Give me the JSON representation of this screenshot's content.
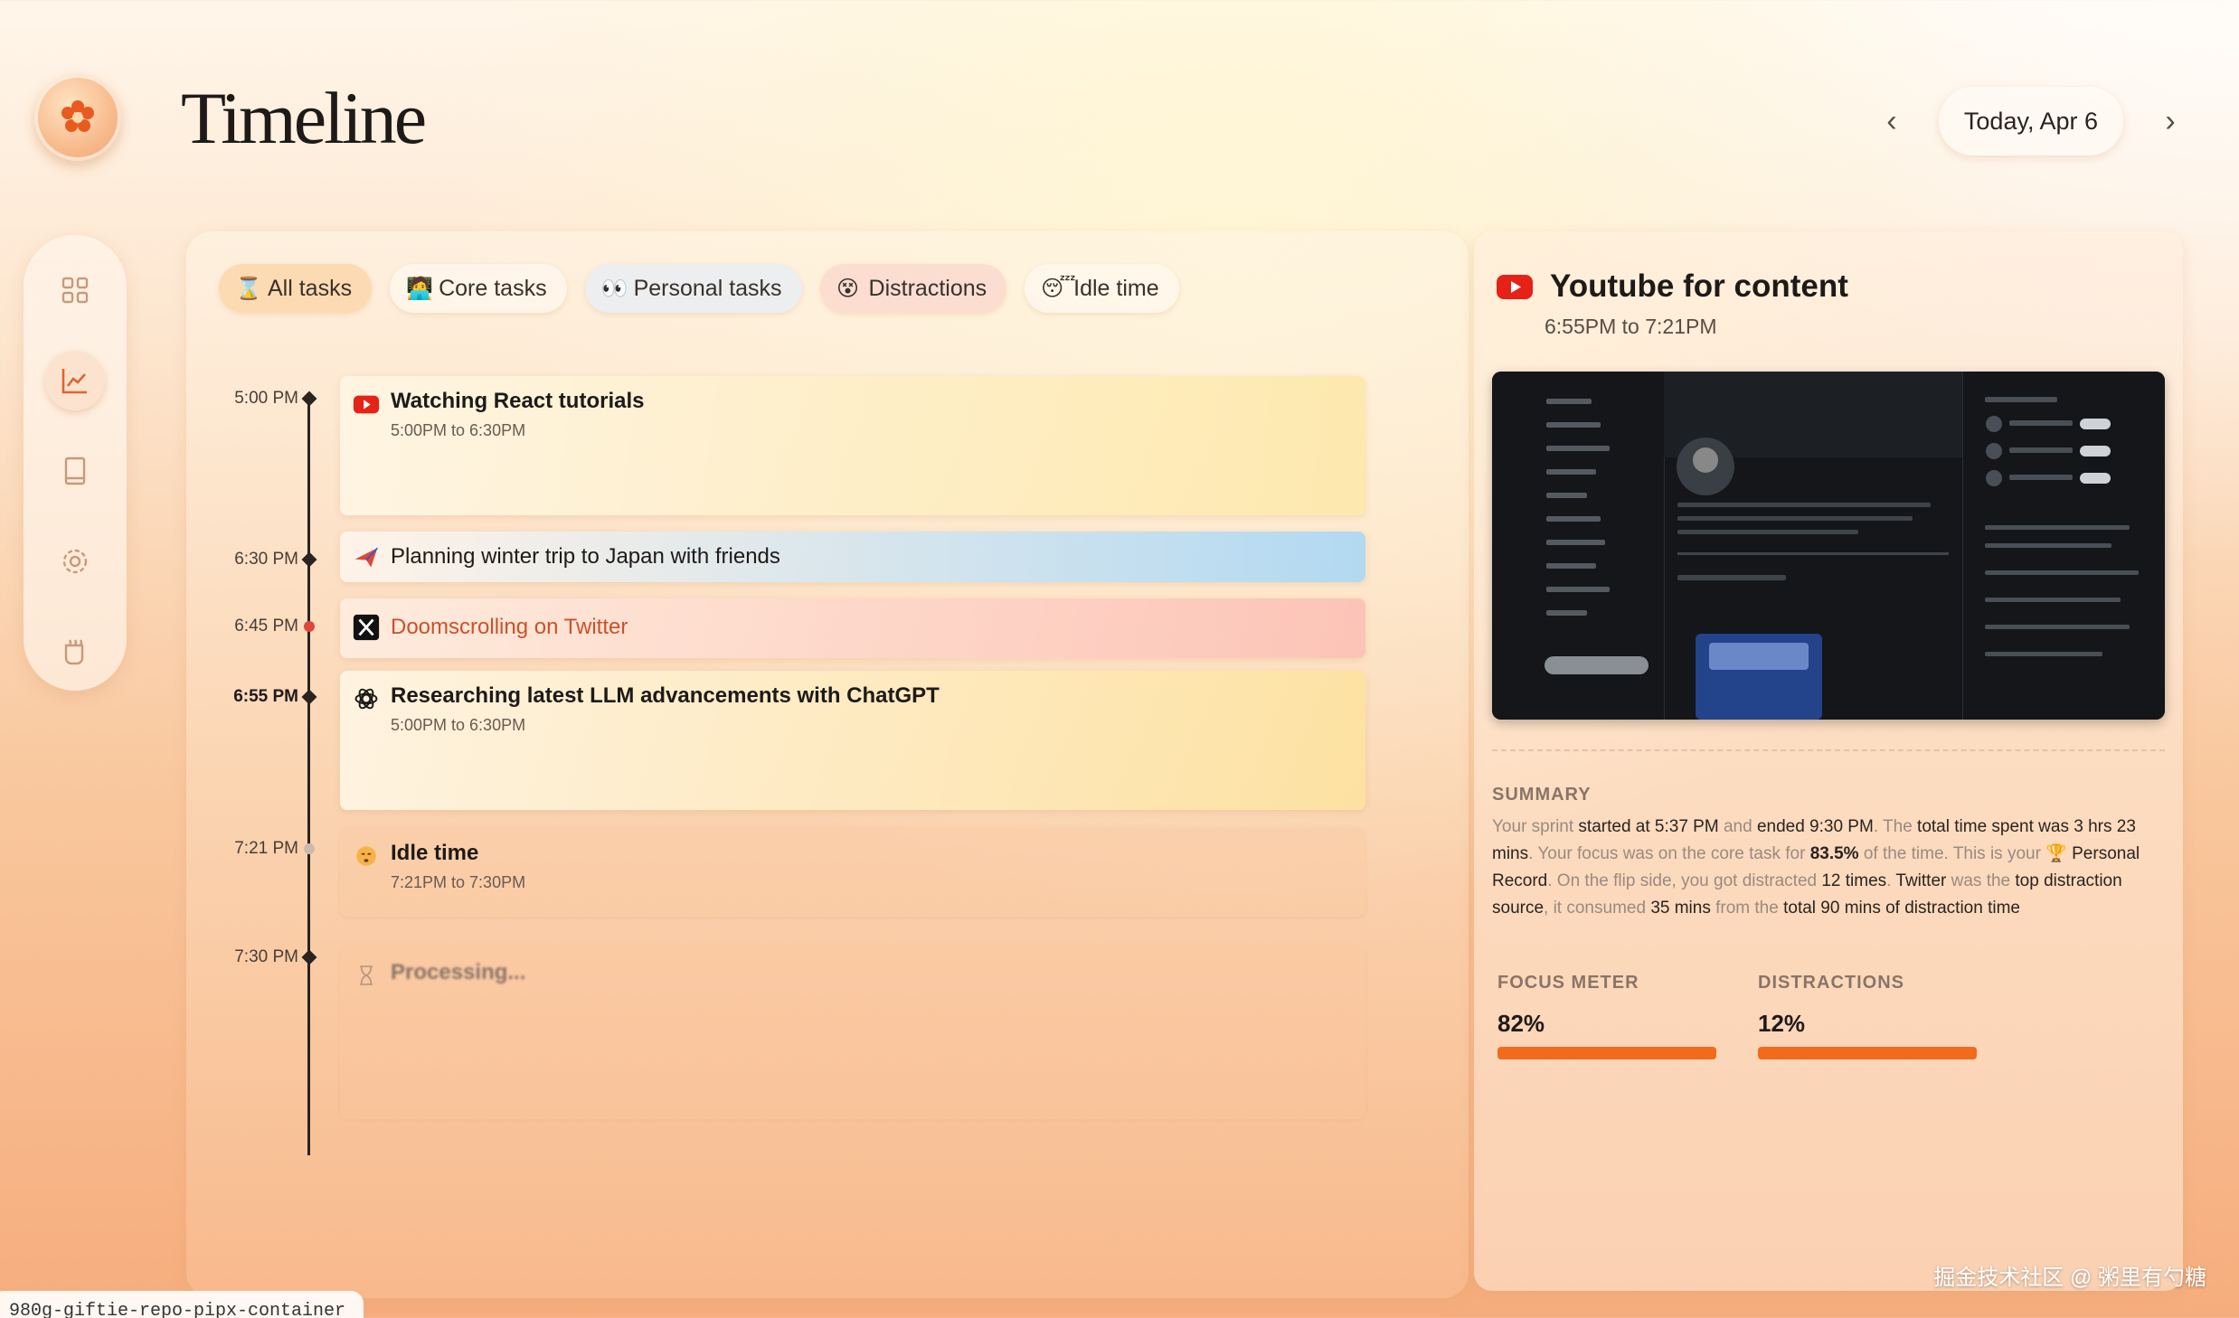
{
  "header": {
    "title": "Timeline",
    "date_label": "Today, Apr 6",
    "prev_arrow": "‹",
    "next_arrow": "›"
  },
  "sidebar": {
    "items": [
      {
        "icon": "grid-icon",
        "active": false
      },
      {
        "icon": "chart-icon",
        "active": true
      },
      {
        "icon": "tablet-icon",
        "active": false
      },
      {
        "icon": "settings-icon",
        "active": false
      },
      {
        "icon": "mug-icon",
        "active": false
      }
    ]
  },
  "filters": [
    {
      "label": "All tasks",
      "icon": "⌛",
      "active": true
    },
    {
      "label": "Core tasks",
      "icon": "🧑‍💻",
      "active": false
    },
    {
      "label": "Personal tasks",
      "icon": "👀",
      "active": false
    },
    {
      "label": "Distractions",
      "icon": "😵",
      "active": false
    },
    {
      "label": "Idle time",
      "icon": "😴",
      "active": false
    }
  ],
  "timeline": {
    "times": [
      "5:00 PM",
      "6:30 PM",
      "6:45 PM",
      "6:55 PM",
      "7:21 PM",
      "7:30 PM"
    ],
    "entries": [
      {
        "title": "Watching React tutorials",
        "sub": "5:00PM to 6:30PM",
        "icon": "youtube-icon"
      },
      {
        "title": "Planning winter trip to Japan with friends",
        "icon": "plane-icon"
      },
      {
        "title": "Doomscrolling on Twitter",
        "icon": "x-icon"
      },
      {
        "title": "Researching latest LLM advancements with ChatGPT",
        "sub": "5:00PM to 6:30PM",
        "icon": "openai-icon"
      },
      {
        "title": "Idle time",
        "sub": "7:21PM to 7:30PM",
        "icon": "idle-icon"
      },
      {
        "title": "Processing...",
        "icon": "hourglass-icon"
      }
    ]
  },
  "detail": {
    "title": "Youtube for content",
    "time_range": "6:55PM to 7:21PM",
    "summary_label": "SUMMARY",
    "summary": {
      "s1": "Your sprint ",
      "s2": "started at 5:37 PM",
      "s3": " and ",
      "s4": "ended 9:30 PM",
      "s5": ". The ",
      "s6": "total time spent was 3 hrs 23 mins",
      "s7": ". Your focus was on the core task for ",
      "s8": "83.5%",
      "s9": " of the time. This is your ",
      "s10": "🏆",
      "s11": " Personal Record",
      "s12": ". On the flip side, you got distracted ",
      "s13": "12 times",
      "s14": ". ",
      "s15": "Twitter",
      "s16": " was the ",
      "s17": "top distraction source",
      "s18": ", it consumed ",
      "s19": "35 mins",
      "s20": " from the ",
      "s21": "total 90 mins of distraction time"
    },
    "meters": [
      {
        "label": "FOCUS METER",
        "value": "82%",
        "fraction": 0.82
      },
      {
        "label": "DISTRACTIONS",
        "value": "12%",
        "fraction": 0.12
      }
    ]
  },
  "watermark": "掘金技术社区 @ 粥里有勺糖",
  "bottom_tag": "980g-giftie-repo-pipx-container",
  "colors": {
    "accent": "#f26a1b",
    "youtube": "#e62117",
    "twitter_text": "#c8522c"
  }
}
